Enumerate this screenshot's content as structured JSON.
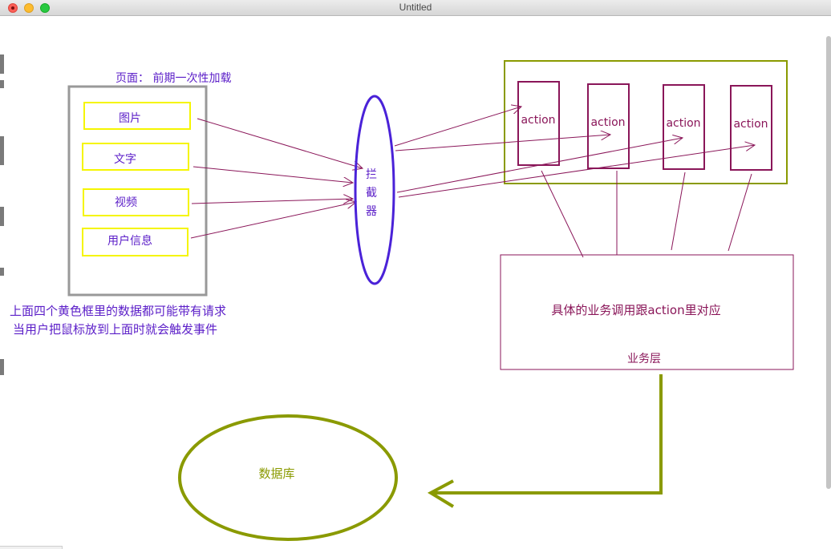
{
  "window": {
    "title": "Untitled"
  },
  "diagram": {
    "page_label": "页面： 前期一次性加载",
    "items": [
      "图片",
      "文字",
      "视频",
      "用户信息"
    ],
    "note_line1": "上面四个黄色框里的数据都可能带有请求",
    "note_line2": "当用户把鼠标放到上面时就会触发事件",
    "interceptor_chars": [
      "拦",
      "截",
      "器"
    ],
    "actions": [
      "action",
      "action",
      "action",
      "action"
    ],
    "business_desc": "具体的业务调用跟action里对应",
    "business_label": "业务层",
    "database_label": "数据库"
  },
  "colors": {
    "purple_text": "#5b1ec8",
    "maroon": "#8a1659",
    "yellow_box": "#f5f500",
    "olive": "#8a9a00",
    "gray_frame": "#999999",
    "interceptor_stroke": "#4a22d8",
    "action_text": "#8a1659",
    "arrow": "#8a1659"
  }
}
